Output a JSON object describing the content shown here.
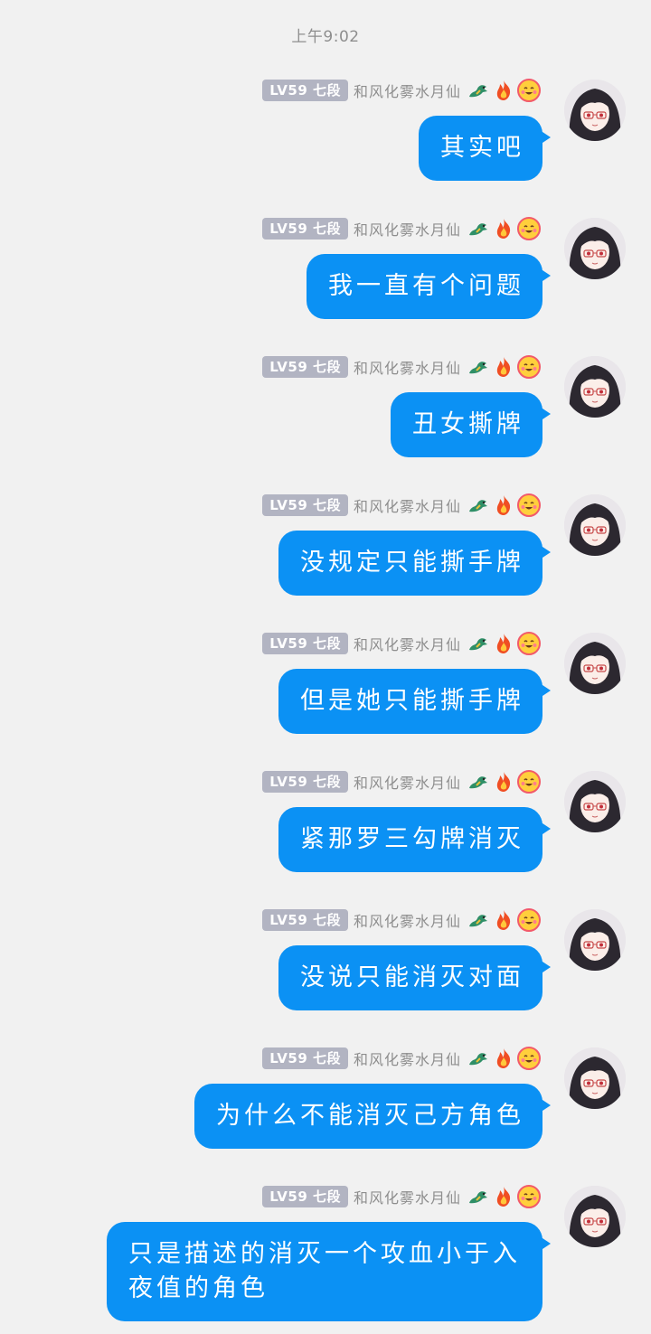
{
  "timestamp": "上午9:02",
  "sender": {
    "level": "LV59 七段",
    "nickname": "和风化雾水月仙"
  },
  "badges": [
    "dragon-icon",
    "fire-icon",
    "blush-smiley-icon"
  ],
  "colors": {
    "bubble": "#0b91f4",
    "background": "#f1f1f1",
    "level_badge": "#b2b4c2"
  },
  "messages": [
    {
      "text": "其实吧"
    },
    {
      "text": "我一直有个问题"
    },
    {
      "text": "丑女撕牌"
    },
    {
      "text": "没规定只能撕手牌"
    },
    {
      "text": "但是她只能撕手牌"
    },
    {
      "text": "紧那罗三勾牌消灭"
    },
    {
      "text": "没说只能消灭对面"
    },
    {
      "text": "为什么不能消灭己方角色"
    },
    {
      "text": "只是描述的消灭一个攻血小于入夜值的角色"
    }
  ]
}
